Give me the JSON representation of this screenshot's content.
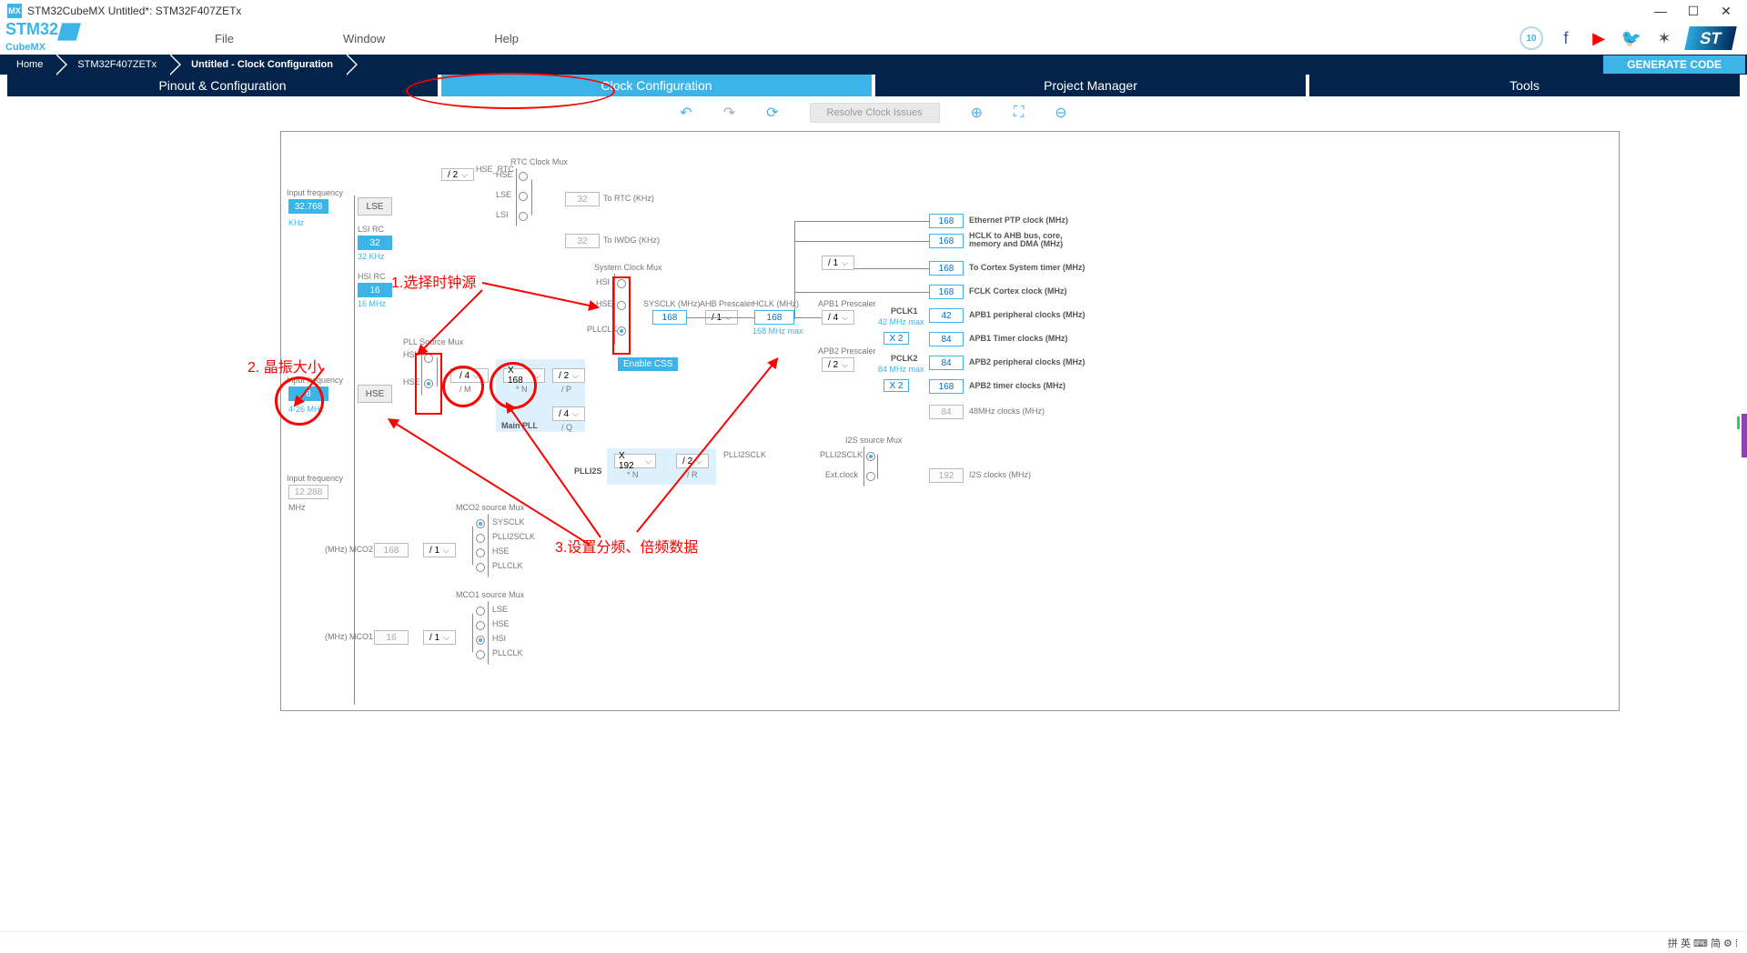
{
  "titlebar": {
    "app_icon_text": "MX",
    "title": "STM32CubeMX Untitled*: STM32F407ZETx"
  },
  "menu": {
    "file": "File",
    "window": "Window",
    "help": "Help"
  },
  "badge": {
    "ten": "10"
  },
  "breadcrumb": {
    "home": "Home",
    "chip": "STM32F407ZETx",
    "page": "Untitled - Clock Configuration",
    "generate": "GENERATE CODE"
  },
  "tabs": {
    "pinout": "Pinout & Configuration",
    "clock": "Clock Configuration",
    "pm": "Project Manager",
    "tools": "Tools"
  },
  "toolbar": {
    "resolve": "Resolve Clock Issues"
  },
  "clk": {
    "lse_freq_label": "Input frequency",
    "lse_val": "32.768",
    "lse_unit": "KHz",
    "lse": "LSE",
    "lsi_label": "LSI RC",
    "lsi_val": "32",
    "lsi_unit": "32 KHz",
    "hsi_label": "HSI RC",
    "hsi_val": "16",
    "hsi_unit": "16 MHz",
    "hse_freq_label": "Input frequency",
    "hse_val": "8",
    "hse_range": "4-26 MHz",
    "hse": "HSE",
    "i2s_freq_label": "Input frequency",
    "i2s_val": "12.288",
    "i2s_unit": "MHz",
    "rtc_mux": "RTC Clock Mux",
    "hse_src": "HSE",
    "lse_src": "LSE",
    "lsi_src": "LSI",
    "rtc_div": "/ 2",
    "hse_rtc": "HSE_RTC",
    "to_rtc": "To RTC (KHz)",
    "rtc_out": "32",
    "to_iwdg": "To IWDG (KHz)",
    "iwdg_out": "32",
    "pll_mux": "PLL Source Mux",
    "hsi_src": "HSI",
    "pllm": "/ 4",
    "pllm_sub": "/ M",
    "plln": "X 168",
    "plln_sub": "* N",
    "pllp": "/ 2",
    "pllp_sub": "/ P",
    "pllq": "/ 4",
    "pllq_sub": "/ Q",
    "main_pll": "Main PLL",
    "sysmux": "System Clock Mux",
    "pllclk_src": "PLLCLK",
    "enable_css": "Enable CSS",
    "sysclk_label": "SYSCLK (MHz)",
    "sysclk": "168",
    "ahb_label": "AHB Prescaler",
    "ahb": "/ 1",
    "hclk_label": "HCLK (MHz)",
    "hclk": "168",
    "hclk_max": "168 MHz max",
    "apb1_label": "APB1 Prescaler",
    "apb1": "/ 4",
    "apb2_label": "APB2 Prescaler",
    "apb2": "/ 2",
    "cortex_div": "/ 1",
    "pclk1_lbl": "PCLK1",
    "pclk1_max": "42 MHz max",
    "pclk2_lbl": "PCLK2",
    "pclk2_max": "84 MHz max",
    "x2": "X 2",
    "out_eth": "168",
    "out_eth_lbl": "Ethernet PTP clock (MHz)",
    "out_hclk": "168",
    "out_hclk_lbl": "HCLK to AHB bus, core, memory and DMA (MHz)",
    "out_cortex": "168",
    "out_cortex_lbl": "To Cortex System timer (MHz)",
    "out_fclk": "168",
    "out_fclk_lbl": "FCLK Cortex clock (MHz)",
    "out_apb1p": "42",
    "out_apb1p_lbl": "APB1 peripheral clocks (MHz)",
    "out_apb1t": "84",
    "out_apb1t_lbl": "APB1 Timer clocks (MHz)",
    "out_apb2p": "84",
    "out_apb2p_lbl": "APB2 peripheral clocks (MHz)",
    "out_apb2t": "168",
    "out_apb2t_lbl": "APB2 timer clocks (MHz)",
    "out_48": "84",
    "out_48_lbl": "48MHz clocks (MHz)",
    "plli2s_lbl": "PLLI2S",
    "plli2s_n": "X 192",
    "plli2s_n_sub": "* N",
    "plli2s_r": "/ 2",
    "plli2s_r_sub": "/ R",
    "plli2sclk": "PLLI2SCLK",
    "i2s_mux": "I2S source Mux",
    "ext_clock": "Ext.clock",
    "i2s_out": "192",
    "i2s_out_lbl": "I2S clocks (MHz)",
    "mco2_mux": "MCO2 source Mux",
    "sysclk_src": "SYSCLK",
    "mco2_lbl": "(MHz) MCO2",
    "mco2_val": "168",
    "mco2_div": "/ 1",
    "mco1_mux": "MCO1 source Mux",
    "mco1_lbl": "(MHz) MCO1",
    "mco1_val": "16",
    "mco1_div": "/ 1"
  },
  "ann": {
    "a1": "1.选择时钟源",
    "a2": "2. 晶振大小",
    "a3": "3.设置分频、倍频数据"
  },
  "taskbar": {
    "ime": "拼 英 ⌨ 简 ⚙ ⁞"
  }
}
